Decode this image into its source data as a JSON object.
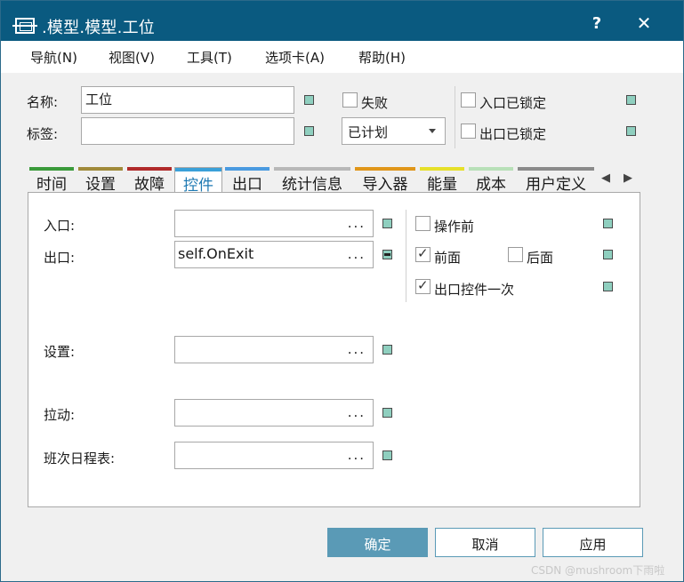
{
  "window": {
    "title": ".模型.模型.工位",
    "help_label": "?",
    "close_label": "✕"
  },
  "menu": {
    "items": [
      {
        "label": "导航(N)"
      },
      {
        "label": "视图(V)"
      },
      {
        "label": "工具(T)"
      },
      {
        "label": "选项卡(A)"
      },
      {
        "label": "帮助(H)"
      }
    ]
  },
  "header": {
    "name_label": "名称:",
    "name_value": "工位",
    "tag_label": "标签:",
    "tag_value": "",
    "failed_label": "失败",
    "failed_checked": false,
    "status_value": "已计划",
    "entry_locked_label": "入口已锁定",
    "entry_locked_checked": false,
    "exit_locked_label": "出口已锁定",
    "exit_locked_checked": false
  },
  "tabs": [
    {
      "label": "时间",
      "color": "#3a9a3a"
    },
    {
      "label": "设置",
      "color": "#a08a3a"
    },
    {
      "label": "故障",
      "color": "#b02a2a"
    },
    {
      "label": "控件",
      "color": "#3aa0d8",
      "active": true
    },
    {
      "label": "出口",
      "color": "#4a9ae0"
    },
    {
      "label": "统计信息",
      "color": "#b8b8b8"
    },
    {
      "label": "导入器",
      "color": "#e0961a"
    },
    {
      "label": "能量",
      "color": "#e6e02a"
    },
    {
      "label": "成本",
      "color": "#b8e0b8"
    },
    {
      "label": "用户定义",
      "color": "#8a8a8a"
    }
  ],
  "tab_nav": {
    "prev": "◀",
    "next": "▶"
  },
  "controls": {
    "entry_label": "入口:",
    "entry_value": "",
    "exit_label": "出口:",
    "exit_value": "self.OnExit",
    "setup_label": "设置:",
    "setup_value": "",
    "pull_label": "拉动:",
    "pull_value": "",
    "shift_label": "班次日程表:",
    "shift_value": "",
    "browse_label": "...",
    "before_action_label": "操作前",
    "before_action_checked": false,
    "front_label": "前面",
    "front_checked": true,
    "rear_label": "后面",
    "rear_checked": false,
    "exit_once_label": "出口控件一次",
    "exit_once_checked": true
  },
  "buttons": {
    "ok": "确定",
    "cancel": "取消",
    "apply": "应用"
  },
  "watermark": "CSDN @mushroom下雨啦"
}
